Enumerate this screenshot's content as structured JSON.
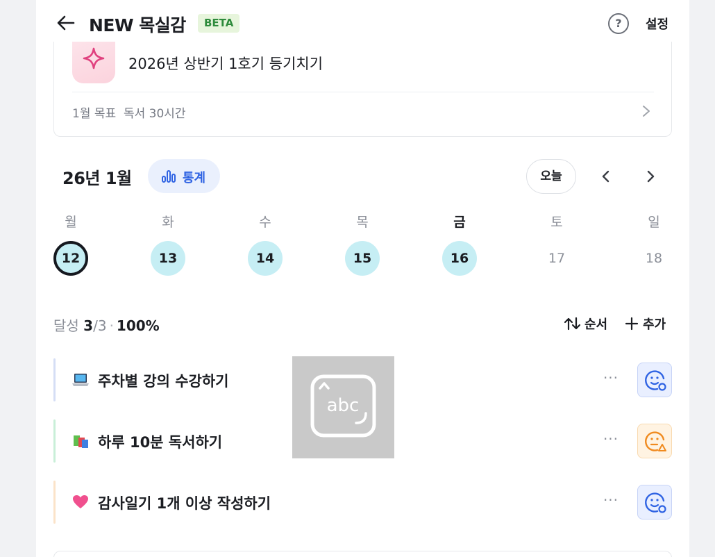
{
  "header": {
    "title": "NEW 목실감",
    "badge": "BETA",
    "help_label": "?",
    "settings_label": "설정"
  },
  "goal": {
    "title": "2026년 상반기 1호기 등기치기",
    "subtitle": "1월 목표  독서 30시간",
    "icon": "sparkle-icon"
  },
  "calendar": {
    "month_label": "26년 1월",
    "stats_label": "통계",
    "today_label": "오늘",
    "weekdays": [
      "월",
      "화",
      "수",
      "목",
      "금",
      "토",
      "일"
    ],
    "days": [
      "12",
      "13",
      "14",
      "15",
      "16",
      "17",
      "18"
    ]
  },
  "progress": {
    "prefix": "달성",
    "done": "3",
    "total": "/3",
    "separator": "·",
    "percent": "100%",
    "order_label": "순서",
    "add_label": "추가"
  },
  "tasks": [
    {
      "label": "주차별 강의 수강하기",
      "emoji": "laptop-icon",
      "bar_color": "#d5def5",
      "status": "smile-clock-icon",
      "status_bg": "#e9efff",
      "status_border": "#c7d4f7",
      "status_color": "#2f63e3"
    },
    {
      "label": "하루 10분 독서하기",
      "emoji": "books-icon",
      "bar_color": "#c9efd8",
      "status": "warning-face-icon",
      "status_bg": "#fff3e2",
      "status_border": "#f9dab0",
      "status_color": "#f08a1e"
    },
    {
      "label": "감사일기 1개 이상 작성하기",
      "emoji": "heart-icon",
      "bar_color": "#fbe3c9",
      "status": "smile-clock-icon",
      "status_bg": "#e9efff",
      "status_border": "#c7d4f7",
      "status_color": "#2f63e3"
    }
  ],
  "overlay": {
    "icon": "keyboard-abc-icon",
    "text": "abc"
  },
  "more_label": "···"
}
